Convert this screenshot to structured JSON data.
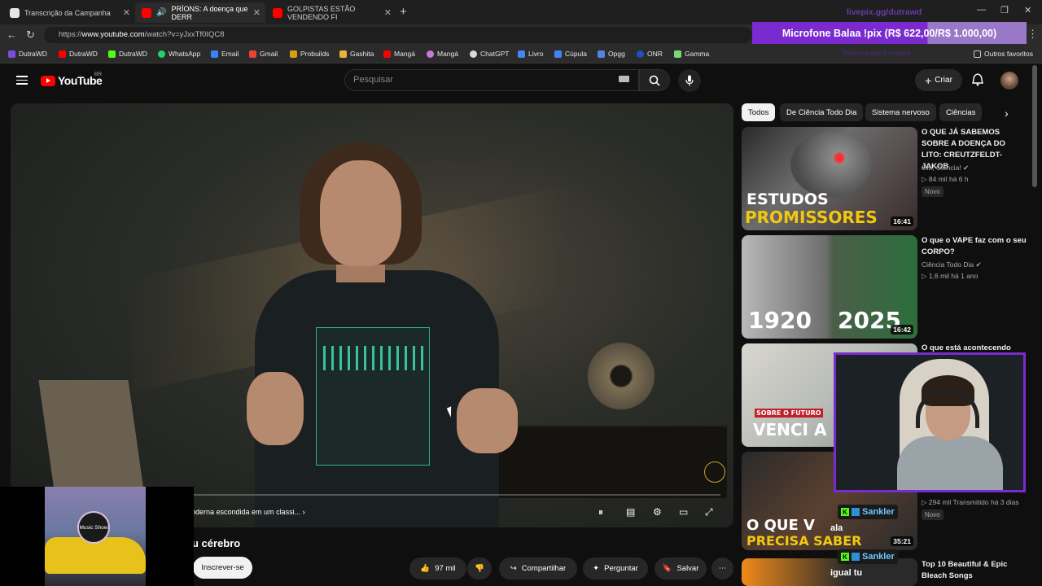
{
  "browser": {
    "tabs": [
      {
        "label": "Transcrição da Campanha",
        "active": false
      },
      {
        "label": "PRÍONS: A doença que DERR",
        "active": true
      },
      {
        "label": "GOLPISTAS ESTÃO VENDENDO FI",
        "active": false
      }
    ],
    "url_prefix": "https://",
    "url_host": "www.youtube.com",
    "url_path": "/watch?v=yJxxTf0IQC8",
    "bookmarks": [
      {
        "label": "DutraWD",
        "color": "#7a4ee0"
      },
      {
        "label": "DutraWD",
        "color": "#ff0000"
      },
      {
        "label": "DutraWD",
        "color": "#53fc18"
      },
      {
        "label": "WhatsApp",
        "color": "#25d366"
      },
      {
        "label": "Email",
        "color": "#3b82f6"
      },
      {
        "label": "Gmail",
        "color": "#ea4335"
      },
      {
        "label": "Probuilds",
        "color": "#d4a017"
      },
      {
        "label": "Gashita",
        "color": "#e8b339"
      },
      {
        "label": "Mangá",
        "color": "#ff0000"
      },
      {
        "label": "Mangá",
        "color": "#c97ad8"
      },
      {
        "label": "ChatGPT",
        "color": "#d9d9d9"
      },
      {
        "label": "Livro",
        "color": "#4285f4"
      },
      {
        "label": "Cúpula",
        "color": "#4285f4"
      },
      {
        "label": "Opgg",
        "color": "#5383e8"
      },
      {
        "label": "ONR",
        "color": "#2050c0"
      },
      {
        "label": "Gamma",
        "color": "#7ad87a"
      }
    ],
    "other_favorites": "Outros favoritos"
  },
  "overlay": {
    "donation_text": "Microfone Balaa !pix (R$ 622,00/R$ 1.000,00)",
    "livepix": "livepix.gg/dutrawd",
    "timer": "Termina em 5 meses"
  },
  "youtube": {
    "logo": "YouTube",
    "region": "BR",
    "search_placeholder": "Pesquisar",
    "create_label": "Criar"
  },
  "video": {
    "chapter": "oderna escondida em um classi...",
    "title": "u cérebro",
    "subscribe_label": "Inscrever-se",
    "likes": "97 mil",
    "share_label": "Compartilhar",
    "ask_label": "Perguntar",
    "save_label": "Salvar"
  },
  "music": {
    "badge": "Music Show"
  },
  "sidebar": {
    "chips": [
      "Todos",
      "De Ciência Todo Dia",
      "Sistema nervoso",
      "Ciências"
    ],
    "videos": [
      {
        "title": "O QUE JÁ SABEMOS SOBRE A DOENÇA DO LITO: CREUTZFELDT-JAKOB",
        "channel": "Olá, Ciência!",
        "meta": "84 mil   há 6 h",
        "badge": "Novo",
        "duration": "16:41",
        "thumb_line1": "ESTUDOS",
        "thumb_line2": "PROMISSORES"
      },
      {
        "title": "O que o VAPE faz com o seu CORPO?",
        "channel": "Ciência Todo Dia",
        "meta": "1,6 mil   há 1 ano",
        "duration": "16:42",
        "thumb_line1": "1920",
        "thumb_line2": "2025"
      },
      {
        "title": "O que está acontecendo",
        "thumb_line1": "SOBRE O FUTURO",
        "thumb_line2": "VENCI A PRIME"
      },
      {
        "meta": "294 mil   Transmitido há 3 dias",
        "badge": "Novo",
        "duration": "35:21",
        "thumb_line1": "O QUE V",
        "thumb_line2": "PRECISA SABER"
      },
      {
        "title": "Top 10 Beautiful & Epic Bleach Songs"
      }
    ]
  },
  "chat": {
    "user": "Sankler",
    "messages": [
      "ala",
      "igual tu"
    ]
  }
}
